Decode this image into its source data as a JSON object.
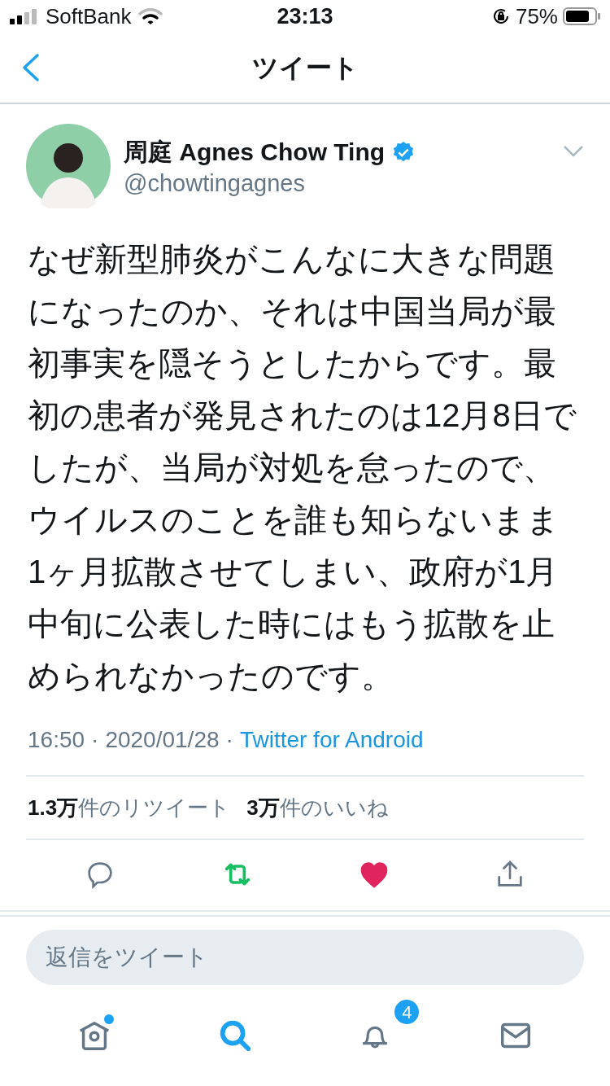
{
  "status_bar": {
    "carrier": "SoftBank",
    "time": "23:13",
    "battery": "75%"
  },
  "nav": {
    "title": "ツイート"
  },
  "author": {
    "name": "周庭 Agnes Chow Ting",
    "verified": true,
    "handle": "@chowtingagnes"
  },
  "tweet": {
    "text": "なぜ新型肺炎がこんなに大きな問題になったのか、それは中国当局が最初事実を隠そうとしたからです。最初の患者が発見されたのは12月8日でしたが、当局が対処を怠ったので、ウイルスのことを誰も知らないまま1ヶ月拡散させてしまい、政府が1月中旬に公表した時にはもう拡散を止められなかったのです。",
    "time": "16:50",
    "date": "2020/01/28",
    "source": "Twitter for Android",
    "separator": "·"
  },
  "stats": [
    "**1.3万**件のリツイート",
    "**3万**件のいいね"
  ],
  "actions": [
    {
      "kind": "reply",
      "active": false
    },
    {
      "kind": "retweet",
      "active": true
    },
    {
      "kind": "like",
      "active": true
    },
    {
      "kind": "share",
      "active": false
    }
  ],
  "reply_field": {
    "placeholder": "返信をツイート"
  },
  "tab_bar": [
    {
      "kind": "home",
      "selected": false,
      "dot": true
    },
    {
      "kind": "search",
      "selected": true
    },
    {
      "kind": "notifications",
      "selected": false,
      "badge": "4"
    },
    {
      "kind": "messages",
      "selected": false
    }
  ]
}
